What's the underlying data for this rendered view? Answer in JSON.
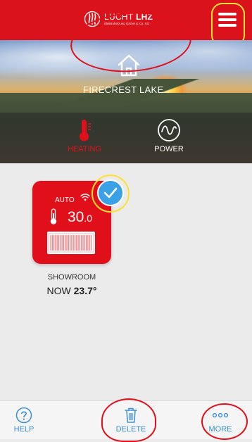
{
  "header": {
    "brand_name_light": "LUCHT",
    "brand_name_bold": "LHZ",
    "brand_sub": "Elektroheizung GmbH & Co. KG",
    "logo_icon": "flame-logo-icon",
    "menu_icon": "hamburger-menu-icon"
  },
  "hero": {
    "location_name": "FIRECREST LAKE",
    "home_icon": "home-icon",
    "tabs": [
      {
        "label": "HEATING",
        "icon": "thermometer-icon",
        "active": true
      },
      {
        "label": "POWER",
        "icon": "power-wave-icon",
        "active": false
      }
    ]
  },
  "device": {
    "mode": "AUTO",
    "temp_int": "30",
    "temp_dec": ".0",
    "room_name": "SHOWROOM",
    "now_label": "NOW",
    "now_value": "23.7°",
    "selected": true
  },
  "bottom_bar": {
    "help_label": "HELP",
    "delete_label": "DELETE",
    "more_label": "MORE"
  },
  "colors": {
    "brand_red": "#d9121b",
    "accent_blue": "#3b8fd9",
    "check_blue": "#3ba1e6",
    "background": "#ebebeb"
  }
}
